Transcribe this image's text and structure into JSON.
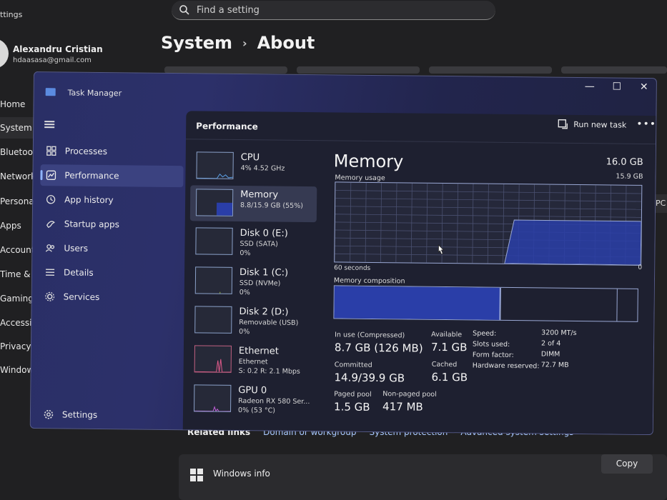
{
  "settings": {
    "app_name": "ttings",
    "search_placeholder": "Find a setting",
    "user_name": "Alexandru Cristian",
    "user_email": "hdaasasa@gmail.com",
    "nav": [
      "Home",
      "System",
      "Bluetooth",
      "Network",
      "Personali",
      "Apps",
      "Accounts",
      "Time & la",
      "Gaming",
      "Accessibil",
      "Privacy &",
      "Windows"
    ],
    "breadcrumb_parent": "System",
    "breadcrumb_sep": "›",
    "breadcrumb_current": "About",
    "related_label": "Related links",
    "related_links": [
      "Domain or workgroup",
      "System protection",
      "Advanced system settings"
    ],
    "windows_info_title": "Windows info",
    "copy_label": "Copy",
    "right_fragment": "PC"
  },
  "task_manager": {
    "title": "Task Manager",
    "controls": {
      "minimize": "—",
      "maximize": "☐",
      "close": "✕"
    },
    "nav": [
      {
        "label": "Processes",
        "icon": "processes-icon"
      },
      {
        "label": "Performance",
        "icon": "performance-icon",
        "active": true
      },
      {
        "label": "App history",
        "icon": "app-history-icon"
      },
      {
        "label": "Startup apps",
        "icon": "startup-apps-icon"
      },
      {
        "label": "Users",
        "icon": "users-icon"
      },
      {
        "label": "Details",
        "icon": "details-icon"
      },
      {
        "label": "Services",
        "icon": "services-icon"
      }
    ],
    "settings_label": "Settings",
    "header_title": "Performance",
    "run_new_task": "Run new task",
    "more": "•••",
    "devices": [
      {
        "name": "CPU",
        "sub1": "4% 4.52 GHz",
        "sub2": ""
      },
      {
        "name": "Memory",
        "sub1": "8.8/15.9 GB (55%)",
        "sub2": "",
        "selected": true
      },
      {
        "name": "Disk 0 (E:)",
        "sub1": "SSD (SATA)",
        "sub2": "0%"
      },
      {
        "name": "Disk 1 (C:)",
        "sub1": "SSD (NVMe)",
        "sub2": "0%"
      },
      {
        "name": "Disk 2 (D:)",
        "sub1": "Removable (USB)",
        "sub2": "0%"
      },
      {
        "name": "Ethernet",
        "sub1": "Ethernet",
        "sub2": "S: 0.2 R: 2.1 Mbps"
      },
      {
        "name": "GPU 0",
        "sub1": "Radeon RX 580 Ser...",
        "sub2": "0% (53 °C)"
      }
    ],
    "memory": {
      "title": "Memory",
      "total": "16.0 GB",
      "usage_label": "Memory usage",
      "usage_max": "15.9 GB",
      "axis_left": "60 seconds",
      "axis_right": "0",
      "composition_label": "Memory composition",
      "usage_fraction": 0.55,
      "composition_in_use_fraction": 0.55,
      "composition_standby_fraction": 0.38,
      "stats": {
        "in_use_label": "In use (Compressed)",
        "in_use_value": "8.7 GB (126 MB)",
        "available_label": "Available",
        "available_value": "7.1 GB",
        "committed_label": "Committed",
        "committed_value": "14.9/39.9 GB",
        "cached_label": "Cached",
        "cached_value": "6.1 GB",
        "paged_label": "Paged pool",
        "paged_value": "1.5 GB",
        "nonpaged_label": "Non-paged pool",
        "nonpaged_value": "417 MB"
      },
      "props": {
        "speed_label": "Speed:",
        "speed_value": "3200 MT/s",
        "slots_label": "Slots used:",
        "slots_value": "2 of 4",
        "form_label": "Form factor:",
        "form_value": "DIMM",
        "hwres_label": "Hardware reserved:",
        "hwres_value": "72.7 MB"
      }
    }
  },
  "colors": {
    "memory_fill": "#2a3ea8",
    "graph_border": "#9aa8d4",
    "accent": "#8fb4ff"
  }
}
